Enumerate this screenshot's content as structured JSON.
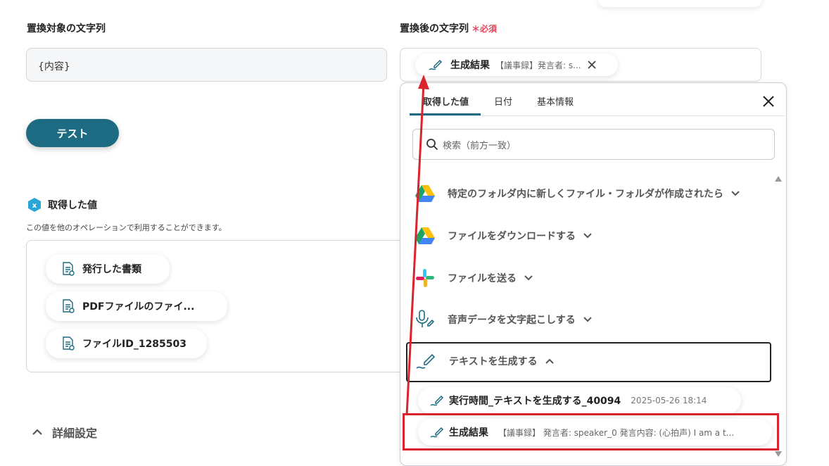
{
  "left": {
    "target_label": "置換対象の文字列",
    "target_value": "{内容}",
    "test_button": "テスト",
    "values_section": {
      "title": "取得した値",
      "description": "この値を他のオペレーションで利用することができます。",
      "items": [
        {
          "label": "発行した書類"
        },
        {
          "label": "PDFファイルのファイ..."
        },
        {
          "label": "ファイルID_1285503"
        }
      ]
    },
    "advanced": "詳細設定"
  },
  "right": {
    "replacement_label": "置換後の文字列",
    "required": "＊必須",
    "chip": {
      "title": "生成結果",
      "snippet": "【議事録】発言者: s..."
    }
  },
  "popup": {
    "tabs": [
      {
        "label": "取得した値",
        "active": true
      },
      {
        "label": "日付",
        "active": false
      },
      {
        "label": "基本情報",
        "active": false
      }
    ],
    "search_placeholder": "検索（前方一致）",
    "groups": [
      {
        "label": "特定のフォルダ内に新しくファイル・フォルダが作成されたら",
        "icon": "google-drive-icon",
        "expanded": false
      },
      {
        "label": "ファイルをダウンロードする",
        "icon": "google-drive-icon",
        "expanded": false
      },
      {
        "label": "ファイルを送る",
        "icon": "slack-icon",
        "expanded": false
      },
      {
        "label": "音声データを文字起こしする",
        "icon": "microphone-pen-icon",
        "expanded": false
      },
      {
        "label": "テキストを生成する",
        "icon": "pen-icon",
        "expanded": true
      }
    ],
    "entries": [
      {
        "title": "実行時間_テキストを生成する_40094",
        "value": "2025-05-26 18:14"
      },
      {
        "title": "生成結果",
        "value": "【議事録】 発言者: speaker_0 発言内容: (心拍声) I am a t..."
      }
    ]
  },
  "colors": {
    "accent": "#1d6b82",
    "required": "#e6455a",
    "highlight": "#d9232d"
  }
}
